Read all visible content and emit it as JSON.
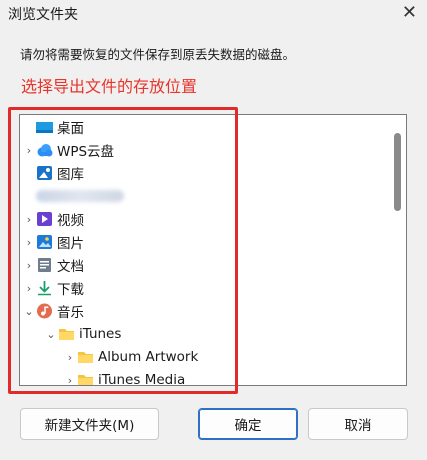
{
  "window": {
    "title": "浏览文件夹",
    "close_glyph": "✕"
  },
  "instruction": "请勿将需要恢复的文件保存到原丢失数据的磁盘。",
  "annotation": {
    "text": "选择导出文件的存放位置",
    "color": "#e8352b"
  },
  "tree": {
    "items": [
      {
        "label": "桌面",
        "icon": "desktop-icon",
        "chevron": ""
      },
      {
        "label": "WPS云盘",
        "icon": "cloud-icon",
        "chevron": "›"
      },
      {
        "label": "图库",
        "icon": "gallery-icon",
        "chevron": ""
      },
      {
        "label": "",
        "icon": "user-folder-icon",
        "chevron": ""
      },
      {
        "label": "视频",
        "icon": "videos-icon",
        "chevron": "›"
      },
      {
        "label": "图片",
        "icon": "pictures-icon",
        "chevron": "›"
      },
      {
        "label": "文档",
        "icon": "documents-icon",
        "chevron": "›"
      },
      {
        "label": "下载",
        "icon": "downloads-icon",
        "chevron": "›"
      },
      {
        "label": "音乐",
        "icon": "music-icon",
        "chevron": "⌄"
      },
      {
        "label": "iTunes",
        "icon": "folder-icon",
        "chevron": "⌄"
      },
      {
        "label": "Album Artwork",
        "icon": "folder-icon",
        "chevron": "›"
      },
      {
        "label": "iTunes Media",
        "icon": "folder-icon",
        "chevron": "›"
      }
    ]
  },
  "buttons": {
    "new_folder": "新建文件夹(M)",
    "ok": "确定",
    "cancel": "取消"
  },
  "colors": {
    "accent": "#2f6fc4",
    "annotation_box": "#e12a2a"
  }
}
